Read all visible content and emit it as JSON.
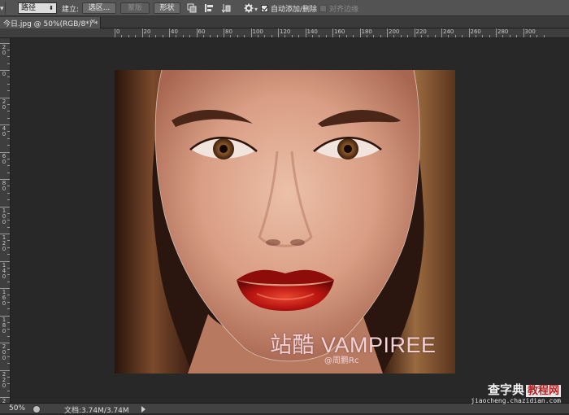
{
  "options_bar": {
    "mode_select": "路径",
    "make_label": "建立:",
    "selection_button": "选区...",
    "mask_button": "蒙版",
    "shape_button": "形状",
    "auto_add_delete_label": "自动添加/删除",
    "auto_add_delete_checked": true,
    "align_edges_label": "对齐边缘",
    "align_edges_checked": false
  },
  "document_tab": {
    "title": "今日.jpg @ 50%(RGB/8*) *",
    "close": "×"
  },
  "ruler": {
    "h_labels": [
      "0",
      "20",
      "40",
      "60",
      "80",
      "100",
      "120",
      "140",
      "160",
      "180",
      "200",
      "220",
      "240",
      "260",
      "280",
      "300"
    ],
    "v_labels": [
      "2\n0",
      "0",
      "2\n0",
      "4\n0",
      "6\n0",
      "8\n0",
      "1\n0\n0",
      "1\n2\n0",
      "1\n4\n0",
      "1\n6\n0",
      "1\n8\n0",
      "2\n0\n0",
      "2\n2\n0",
      "2\n4\n0"
    ]
  },
  "canvas": {
    "caption": "站酷 VAMPIREE",
    "credit": "@周鹏Rc"
  },
  "status_bar": {
    "zoom": "50%",
    "doc_info": "文档:3.74M/3.74M"
  },
  "watermark": {
    "site_prefix": "查字典",
    "site_box": "教程网",
    "url": "jiaocheng.chazidian.com"
  }
}
